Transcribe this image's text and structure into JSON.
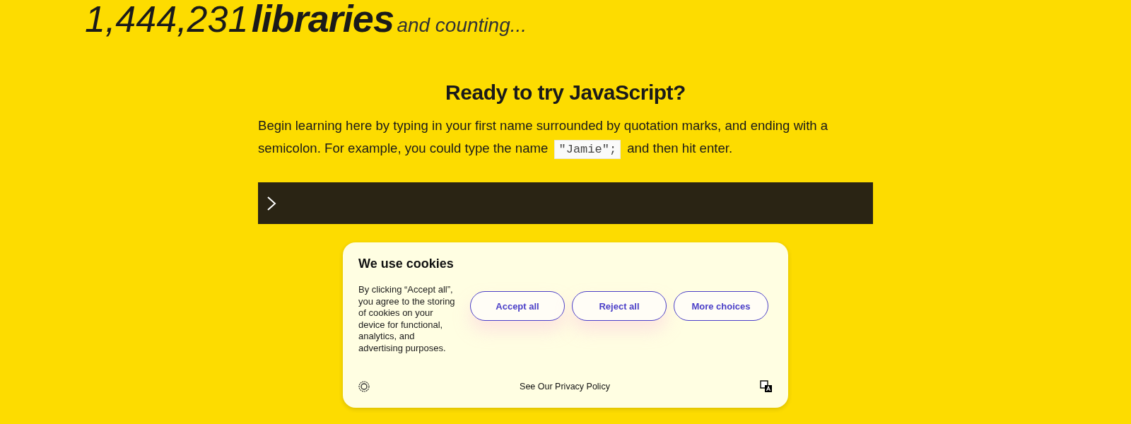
{
  "hero": {
    "count": "1,444,231",
    "noun": "libraries",
    "suffix": "and counting..."
  },
  "intro": {
    "title": "Ready to try JavaScript?",
    "text_before": "Begin learning here by typing in your first name surrounded by quotation marks, and ending with a semicolon. For example, you could type the name",
    "code": "\"Jamie\";",
    "text_after": "and then hit enter."
  },
  "cookie_banner": {
    "title": "We use cookies",
    "text": "By clicking “Accept all”, you agree to the storing of cookies on your device for functional, analytics, and advertising purposes.",
    "buttons": [
      "Accept all",
      "Reject all",
      "More choices"
    ],
    "privacy_link": "See Our Privacy Policy"
  }
}
